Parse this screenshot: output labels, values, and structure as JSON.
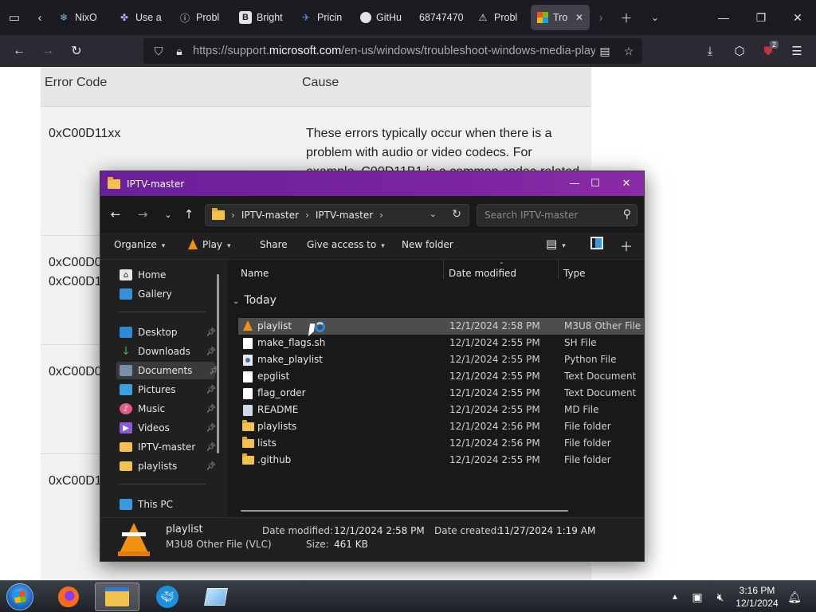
{
  "browser": {
    "tabs": [
      {
        "label": "NixO",
        "icon": "snowflake-icon"
      },
      {
        "label": "Use a",
        "icon": "puzzle-icon"
      },
      {
        "label": "Probl",
        "icon": "info-icon"
      },
      {
        "label": "Bright",
        "icon": "b-icon"
      },
      {
        "label": "Pricin",
        "icon": "bird-icon"
      },
      {
        "label": "GitHu",
        "icon": "github-icon"
      },
      {
        "label": "68747470",
        "icon": ""
      },
      {
        "label": "Probl",
        "icon": "warning-icon"
      },
      {
        "label": "Tro",
        "icon": "microsoft-icon",
        "active": true
      }
    ],
    "url_prefix": "https://support.",
    "url_domain": "microsoft.com",
    "url_suffix": "/en-us/windows/troubleshoot-windows-media-player",
    "extension_badge": "2"
  },
  "webpage": {
    "col_error_code": "Error Code",
    "col_cause": "Cause",
    "row1_code": "0xC00D11xx",
    "row1_cause": "These errors typically occur when there is a problem with audio or video codecs. For example, C00D11B1 is a common codec-related",
    "row2_code": "0xC00D0\n0xC00D1",
    "row3_code": "0xC00D0",
    "row4_code": "0xC00D1"
  },
  "explorer": {
    "title": "IPTV-master",
    "breadcrumb": [
      "IPTV-master",
      "IPTV-master"
    ],
    "search_placeholder": "Search IPTV-master",
    "commands": {
      "organize": "Organize",
      "play": "Play",
      "share": "Share",
      "give_access": "Give access to",
      "new_folder": "New folder"
    },
    "sidebar": [
      {
        "label": "Home",
        "icon": "home-icon",
        "color": "#e8e8e8"
      },
      {
        "label": "Gallery",
        "icon": "gallery-icon",
        "color": "#3a8fd8"
      },
      {
        "label": "Desktop",
        "icon": "desktop-icon",
        "color": "#2e8ad8",
        "pinned": true
      },
      {
        "label": "Downloads",
        "icon": "downloads-icon",
        "color": "#3fae4f",
        "pinned": true
      },
      {
        "label": "Documents",
        "icon": "documents-icon",
        "color": "#7a8ea8",
        "pinned": true,
        "selected": true
      },
      {
        "label": "Pictures",
        "icon": "pictures-icon",
        "color": "#3aa0e0",
        "pinned": true
      },
      {
        "label": "Music",
        "icon": "music-icon",
        "color": "#e05a8a",
        "pinned": true
      },
      {
        "label": "Videos",
        "icon": "videos-icon",
        "color": "#8a5ad8",
        "pinned": true
      },
      {
        "label": "IPTV-master",
        "icon": "folder-icon",
        "color": "#f2c14e",
        "pinned": true
      },
      {
        "label": "playlists",
        "icon": "folder-icon",
        "color": "#f2c14e",
        "pinned": true
      },
      {
        "label": "This PC",
        "icon": "this-pc-icon",
        "color": "#3a9ae0"
      }
    ],
    "columns": {
      "name": "Name",
      "date": "Date modified",
      "type": "Type"
    },
    "group_label": "Today",
    "files": [
      {
        "name": "playlist",
        "date": "12/1/2024 2:58 PM",
        "type": "M3U8 Other File (...",
        "icon": "vlc",
        "selected": true
      },
      {
        "name": "make_flags.sh",
        "date": "12/1/2024 2:55 PM",
        "type": "SH File",
        "icon": "file"
      },
      {
        "name": "make_playlist",
        "date": "12/1/2024 2:55 PM",
        "type": "Python File",
        "icon": "py"
      },
      {
        "name": "epglist",
        "date": "12/1/2024 2:55 PM",
        "type": "Text Document",
        "icon": "file"
      },
      {
        "name": "flag_order",
        "date": "12/1/2024 2:55 PM",
        "type": "Text Document",
        "icon": "file"
      },
      {
        "name": "README",
        "date": "12/1/2024 2:55 PM",
        "type": "MD File",
        "icon": "md"
      },
      {
        "name": "playlists",
        "date": "12/1/2024 2:56 PM",
        "type": "File folder",
        "icon": "folder"
      },
      {
        "name": "lists",
        "date": "12/1/2024 2:56 PM",
        "type": "File folder",
        "icon": "folder"
      },
      {
        "name": ".github",
        "date": "12/1/2024 2:55 PM",
        "type": "File folder",
        "icon": "folder"
      }
    ],
    "details": {
      "name": "playlist",
      "kind": "M3U8 Other File (VLC)",
      "modified_label": "Date modified:",
      "modified_value": "12/1/2024 2:58 PM",
      "created_label": "Date created:",
      "created_value": "11/27/2024 1:19 AM",
      "size_label": "Size:",
      "size_value": "461 KB"
    }
  },
  "taskbar": {
    "time": "3:16 PM",
    "date": "12/1/2024"
  }
}
